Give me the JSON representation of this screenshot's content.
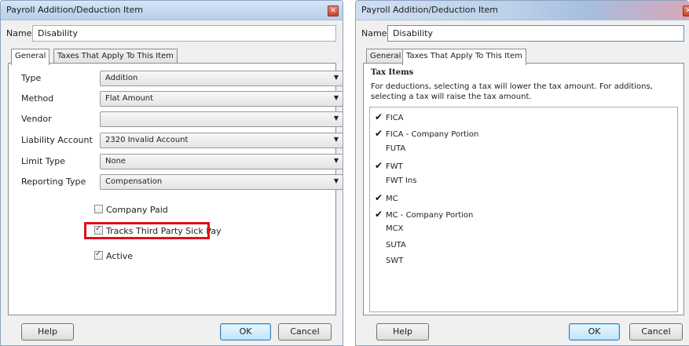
{
  "left_dialog": {
    "title": "Payroll Addition/Deduction Item",
    "name_label": "Name",
    "name_value": "Disability",
    "tabs": [
      {
        "label": "General",
        "active": true
      },
      {
        "label": "Taxes That Apply To This Item",
        "active": false
      }
    ],
    "fields": [
      {
        "label": "Type",
        "value": "Addition"
      },
      {
        "label": "Method",
        "value": "Flat Amount"
      },
      {
        "label": "Vendor",
        "value": ""
      },
      {
        "label": "Liability Account",
        "value": "2320 Invalid Account"
      },
      {
        "label": "Limit Type",
        "value": "None"
      },
      {
        "label": "Reporting Type",
        "value": "Compensation"
      }
    ],
    "checkboxes": [
      {
        "label": "Company Paid",
        "checked": false
      },
      {
        "label": "Tracks Third Party Sick Pay",
        "checked": true
      },
      {
        "label": "Active",
        "checked": true
      }
    ],
    "help_label": "Help",
    "ok_label": "OK",
    "cancel_label": "Cancel"
  },
  "right_dialog": {
    "title": "Payroll Addition/Deduction Item",
    "name_label": "Name",
    "name_value": "Disability",
    "tabs": [
      {
        "label": "General",
        "active": false
      },
      {
        "label": "Taxes That Apply To This Item",
        "active": true
      }
    ],
    "tax_header": "Tax Items",
    "tax_description": "For deductions, selecting a tax will lower the tax amount.  For additions, selecting a tax will raise the tax amount.",
    "tax_items": [
      {
        "name": "FICA",
        "checked": true
      },
      {
        "name": "FICA - Company Portion",
        "checked": true
      },
      {
        "name": "FUTA",
        "checked": false
      },
      {
        "name": "FWT",
        "checked": true
      },
      {
        "name": "FWT Ins",
        "checked": false
      },
      {
        "name": "MC",
        "checked": true
      },
      {
        "name": "MC - Company Portion",
        "checked": true
      },
      {
        "name": "MCX",
        "checked": false
      },
      {
        "name": "SUTA",
        "checked": false
      },
      {
        "name": "SWT",
        "checked": false
      }
    ],
    "help_label": "Help",
    "ok_label": "OK",
    "cancel_label": "Cancel"
  },
  "colors": {
    "highlight": "#e0101a",
    "titlebar": "#c4d8ef",
    "dialog_bg": "#f0f0f0"
  }
}
